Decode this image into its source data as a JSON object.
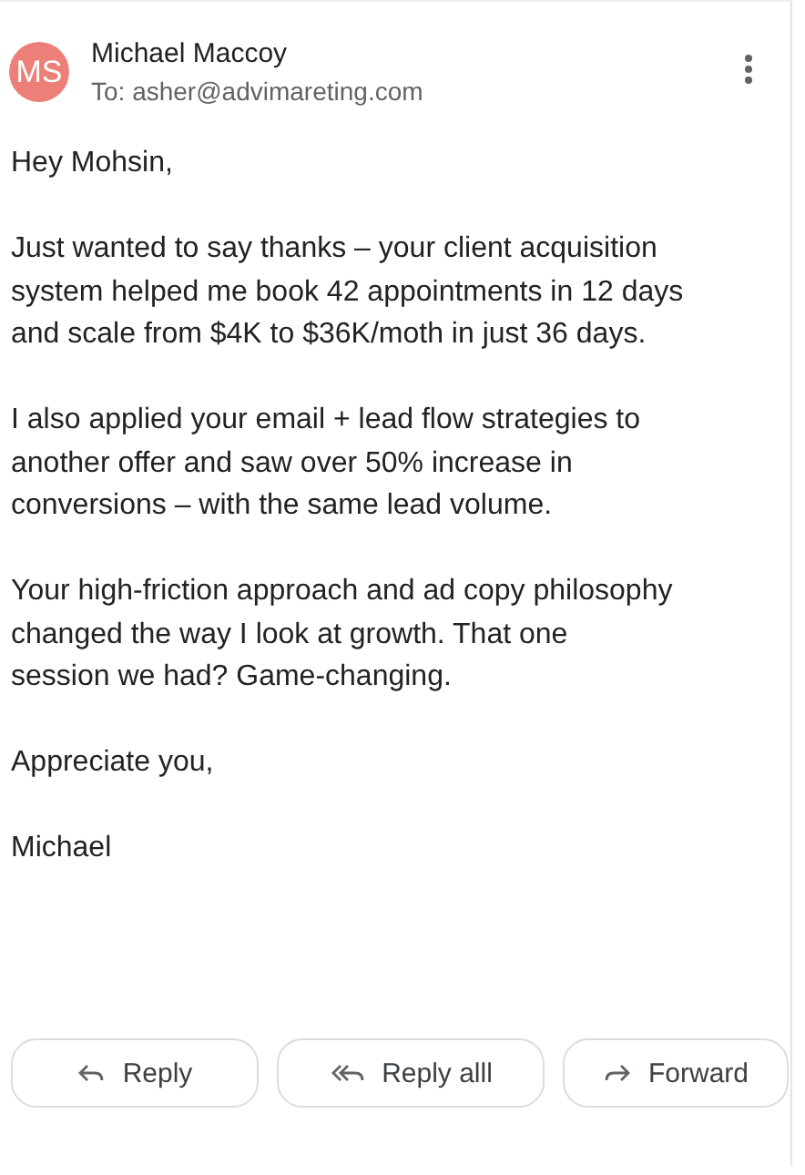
{
  "sender": {
    "initials": "MS",
    "name": "Michael Maccoy",
    "to": "To: asher@advimareting.com"
  },
  "body": [
    {
      "lines": [
        "Hey Mohsin,"
      ]
    },
    {
      "lines": [
        "Just wanted to say thanks – your client acquisition",
        "system helped me book 42 appointments in 12 days",
        "and scale from $4K to $36K/moth in just 36 days."
      ]
    },
    {
      "lines": [
        "I also applied your email + lead flow strategies to",
        "another offer and saw over 50% increase in",
        "conversions – with the same lead volume."
      ]
    },
    {
      "lines": [
        "Your high-friction approach and ad copy philosophy",
        "changed the way I look at growth. That one",
        "session we had? Game-changing."
      ]
    },
    {
      "lines": [
        "Appreciate you,"
      ]
    },
    {
      "lines": [
        "Michael"
      ]
    }
  ],
  "actions": [
    {
      "kind": "reply",
      "label": "Reply"
    },
    {
      "kind": "reply_all",
      "label": "Reply alll"
    },
    {
      "kind": "forward",
      "label": "Forward"
    }
  ]
}
